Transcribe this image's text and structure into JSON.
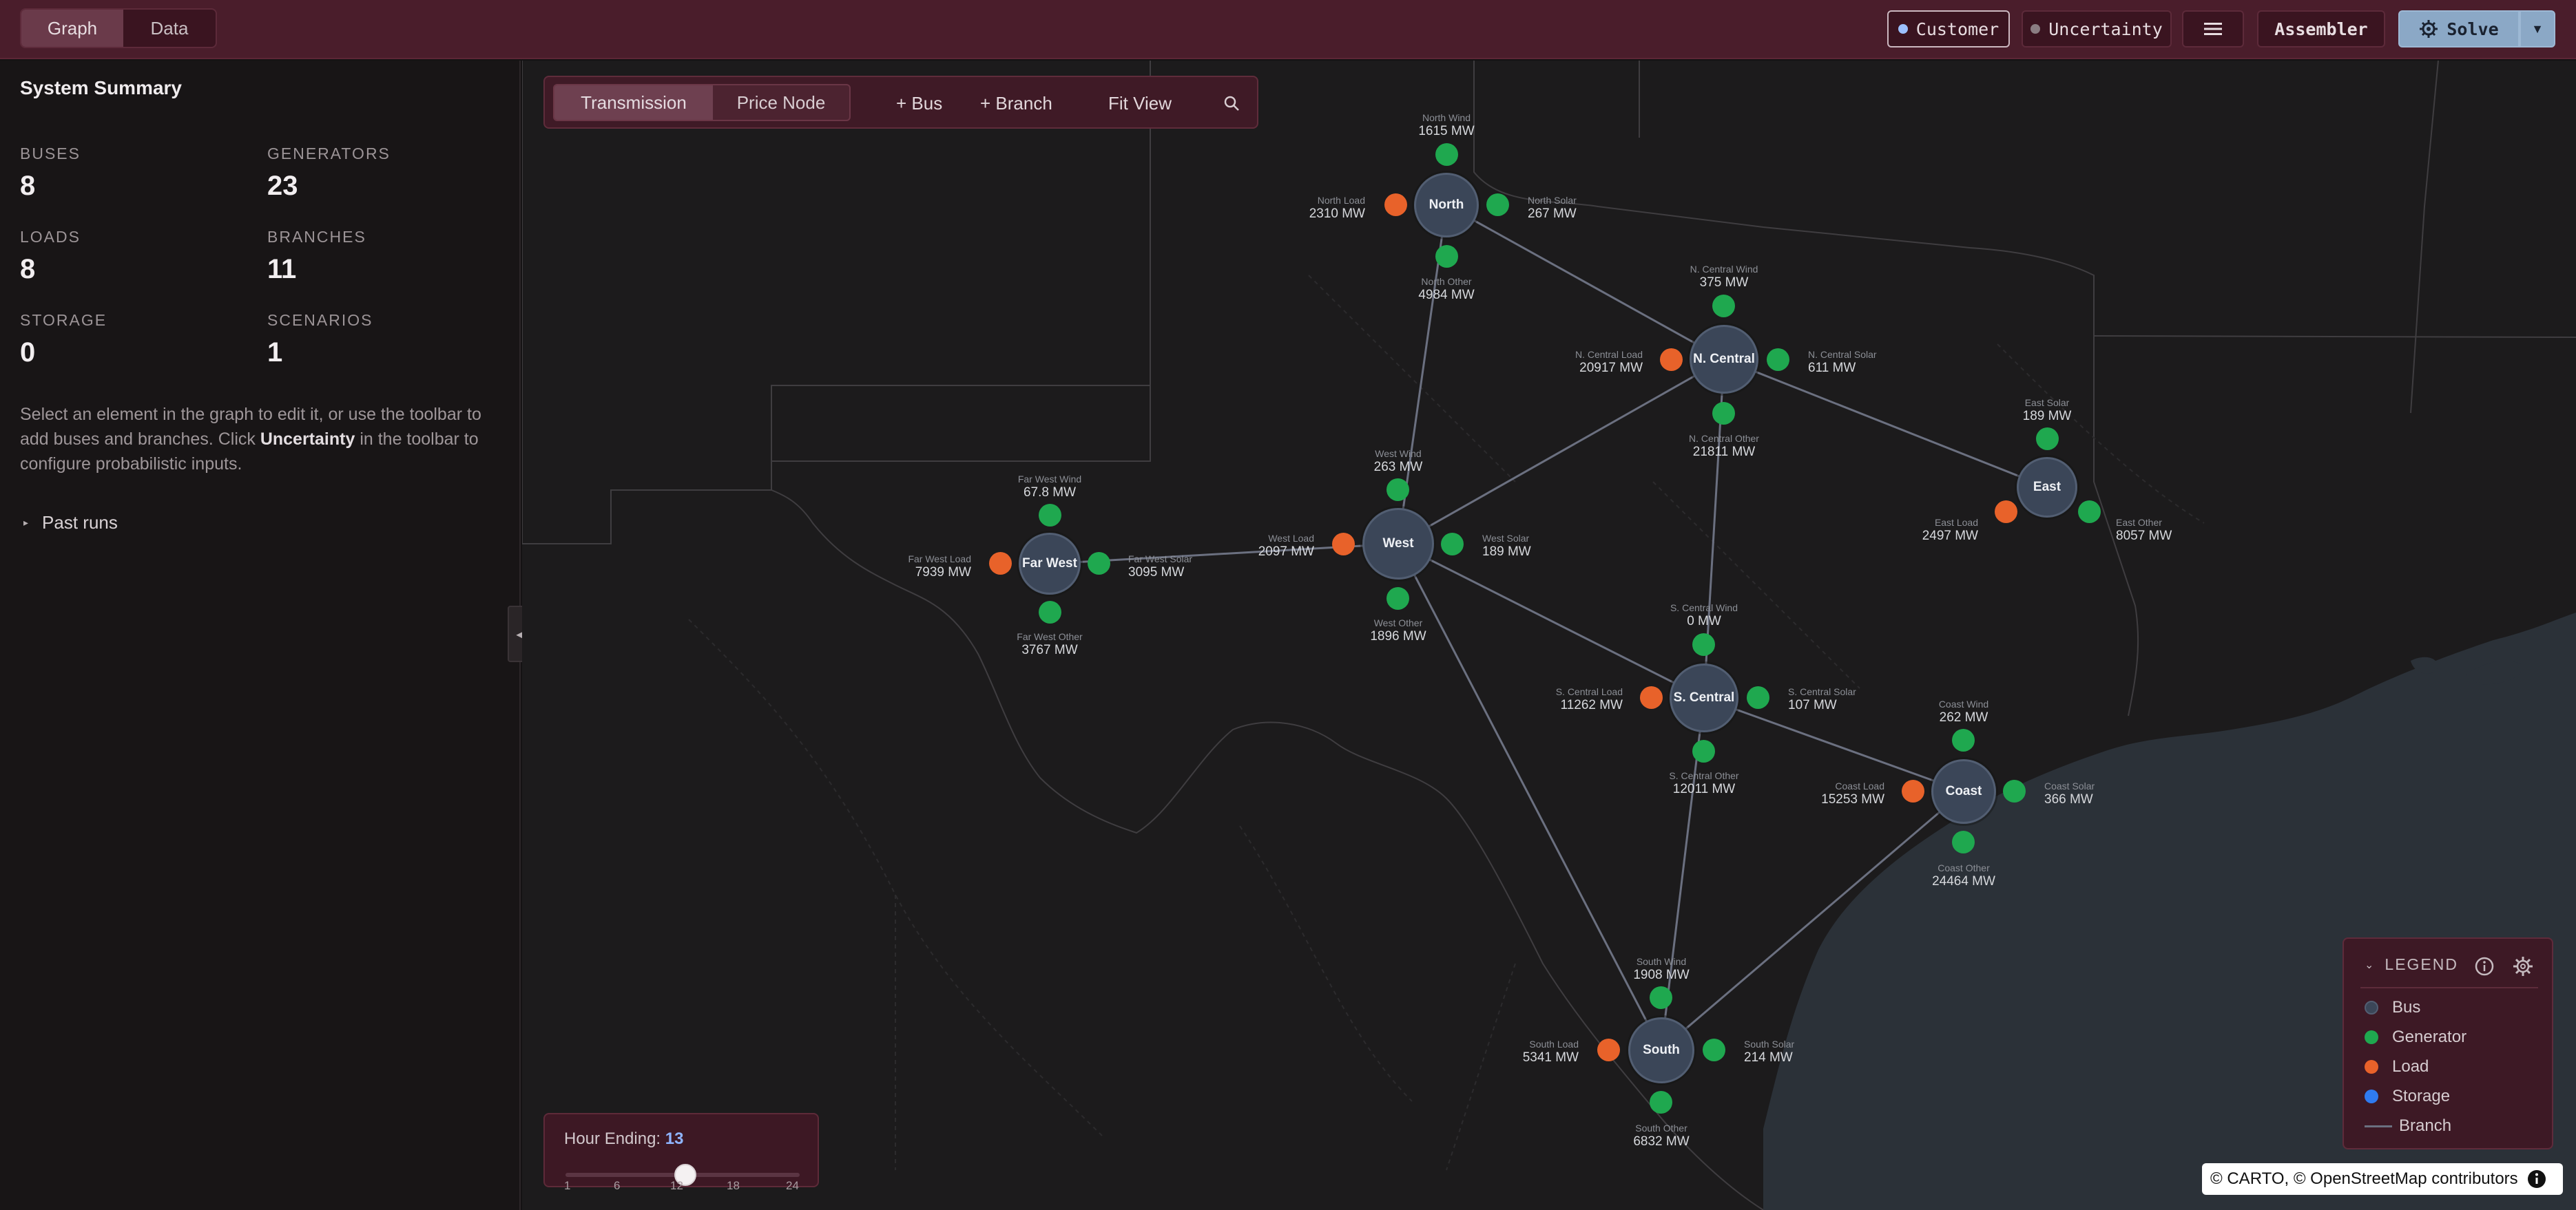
{
  "topbar": {
    "view_tabs": [
      {
        "label": "Graph",
        "active": true
      },
      {
        "label": "Data",
        "active": false
      }
    ],
    "customer_label": "Customer",
    "uncertainty_label": "Uncertainty",
    "menu_icon": "hamburger-menu-icon",
    "assembler_label": "Assembler",
    "solve_label": "Solve",
    "solve_icon": "gear-icon",
    "dropdown_icon": "caret-down-icon"
  },
  "sidebar": {
    "title": "System Summary",
    "stats": [
      {
        "label": "BUSES",
        "value": "8"
      },
      {
        "label": "GENERATORS",
        "value": "23"
      },
      {
        "label": "LOADS",
        "value": "8"
      },
      {
        "label": "BRANCHES",
        "value": "11"
      },
      {
        "label": "STORAGE",
        "value": "0"
      },
      {
        "label": "SCENARIOS",
        "value": "1"
      }
    ],
    "help_pre": "Select an element in the graph to edit it, or use the toolbar to add buses and branches. Click ",
    "help_bold": "Uncertainty",
    "help_post": " in the toolbar to configure probabilistic inputs.",
    "past_runs_label": "Past runs",
    "past_runs_icon": "caret-right-icon",
    "collapse_icon": "chevron-left-icon"
  },
  "graph_toolbar": {
    "tabs": [
      {
        "label": "Transmission",
        "active": true
      },
      {
        "label": "Price Node",
        "active": false
      }
    ],
    "add_bus_label": "+ Bus",
    "add_branch_label": "+ Branch",
    "fit_view_label": "Fit View",
    "search_icon": "search-icon"
  },
  "buses": [
    {
      "id": "north",
      "name": "North",
      "wind": {
        "name": "North Wind",
        "value": "1615 MW"
      },
      "load": {
        "name": "North Load",
        "value": "2310 MW"
      },
      "solar": {
        "name": "North Solar",
        "value": "267 MW"
      },
      "other": {
        "name": "North Other",
        "value": "4984 MW"
      }
    },
    {
      "id": "ncentral",
      "name": "N. Central",
      "wind": {
        "name": "N. Central Wind",
        "value": "375 MW"
      },
      "load": {
        "name": "N. Central Load",
        "value": "20917 MW"
      },
      "solar": {
        "name": "N. Central Solar",
        "value": "611 MW"
      },
      "other": {
        "name": "N. Central Other",
        "value": "21811 MW"
      }
    },
    {
      "id": "east",
      "name": "East",
      "wind": {
        "name": "East Solar",
        "value": "189 MW"
      },
      "load": {
        "name": "East Load",
        "value": "2497 MW"
      },
      "solar": {
        "name": "East Other",
        "value": "8057 MW"
      }
    },
    {
      "id": "farwest",
      "name": "Far West",
      "wind": {
        "name": "Far West Wind",
        "value": "67.8 MW"
      },
      "load": {
        "name": "Far West Load",
        "value": "7939 MW"
      },
      "solar": {
        "name": "Far West Solar",
        "value": "3095 MW"
      },
      "other": {
        "name": "Far West Other",
        "value": "3767 MW"
      }
    },
    {
      "id": "west",
      "name": "West",
      "wind": {
        "name": "West Wind",
        "value": "263 MW"
      },
      "load": {
        "name": "West Load",
        "value": "2097 MW"
      },
      "solar": {
        "name": "West Solar",
        "value": "189 MW"
      },
      "other": {
        "name": "West Other",
        "value": "1896 MW"
      }
    },
    {
      "id": "scentral",
      "name": "S. Central",
      "wind": {
        "name": "S. Central Wind",
        "value": "0 MW"
      },
      "load": {
        "name": "S. Central Load",
        "value": "11262 MW"
      },
      "solar": {
        "name": "S. Central Solar",
        "value": "107 MW"
      },
      "other": {
        "name": "S. Central Other",
        "value": "12011 MW"
      }
    },
    {
      "id": "coast",
      "name": "Coast",
      "wind": {
        "name": "Coast Wind",
        "value": "262 MW"
      },
      "load": {
        "name": "Coast Load",
        "value": "15253 MW"
      },
      "solar": {
        "name": "Coast Solar",
        "value": "366 MW"
      },
      "other": {
        "name": "Coast Other",
        "value": "24464 MW"
      }
    },
    {
      "id": "south",
      "name": "South",
      "wind": {
        "name": "South Wind",
        "value": "1908 MW"
      },
      "load": {
        "name": "South Load",
        "value": "5341 MW"
      },
      "solar": {
        "name": "South Solar",
        "value": "214 MW"
      },
      "other": {
        "name": "South Other",
        "value": "6832 MW"
      }
    }
  ],
  "hour_slider": {
    "label": "Hour Ending:",
    "value": "13",
    "ticks": [
      "1",
      "6",
      "12",
      "18",
      "24"
    ]
  },
  "legend": {
    "title": "LEGEND",
    "collapse_icon": "chevron-down-icon",
    "info_icon": "info-icon",
    "settings_icon": "gear-icon",
    "items": [
      {
        "label": "Bus",
        "color": "#3b4658"
      },
      {
        "label": "Generator",
        "color": "#1fa84f"
      },
      {
        "label": "Load",
        "color": "#e8622a"
      },
      {
        "label": "Storage",
        "color": "#2f7bf0"
      },
      {
        "label": "Branch",
        "color": "#6b7080"
      }
    ]
  },
  "attribution": {
    "text": "© CARTO, © OpenStreetMap contributors",
    "info_icon": "info-icon"
  },
  "colors": {
    "topbar": "#4a1d2b",
    "bus": "#3b4658",
    "generator": "#1fa84f",
    "load": "#e8622a",
    "storage": "#2f7bf0",
    "branch": "#6b7080",
    "accent": "#8fb4ff"
  }
}
